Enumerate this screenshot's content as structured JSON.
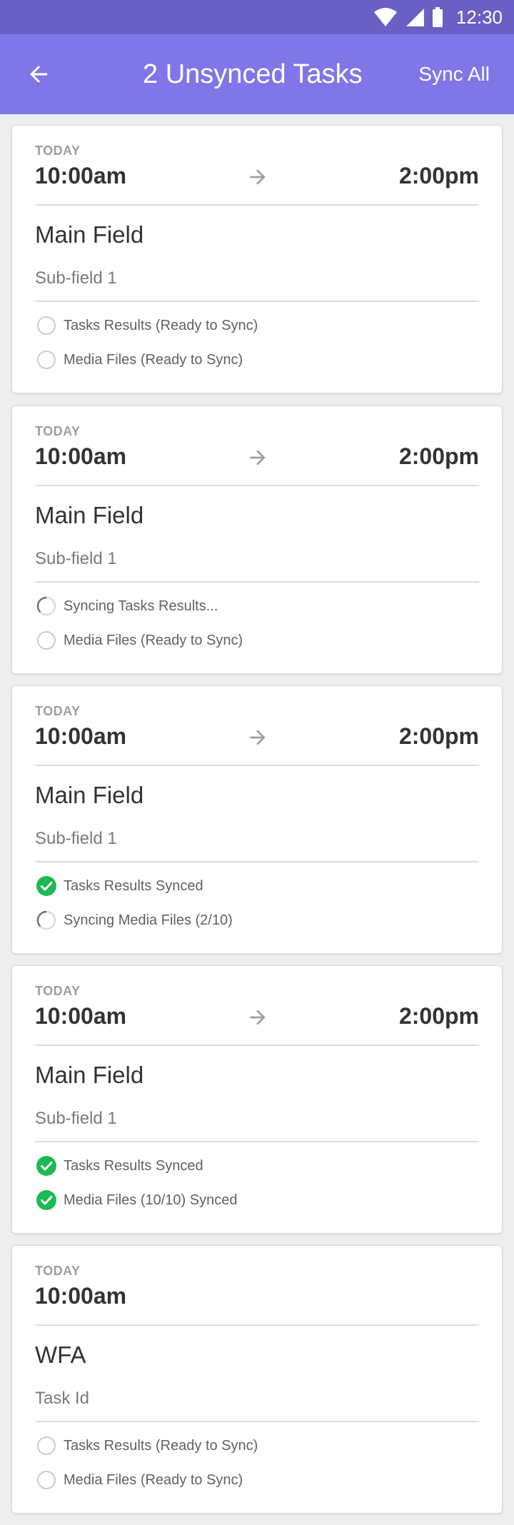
{
  "status_bar": {
    "time": "12:30",
    "icons": [
      "wifi-icon",
      "signal-icon",
      "battery-icon"
    ]
  },
  "app_bar": {
    "back_icon": "arrow-left-icon",
    "title": "2 Unsynced Tasks",
    "sync_all_label": "Sync All"
  },
  "colors": {
    "primary": "#7f77e8",
    "status_bar": "#6a5fc4",
    "success": "#1db954",
    "pending": "#cccccc"
  },
  "cards": [
    {
      "day": "TODAY",
      "start": "10:00am",
      "end": "2:00pm",
      "show_end": true,
      "main": "Main Field",
      "sub": "Sub-field 1",
      "statuses": [
        {
          "state": "pending",
          "label": "Tasks Results (Ready to Sync)"
        },
        {
          "state": "pending",
          "label": "Media Files (Ready to Sync)"
        }
      ]
    },
    {
      "day": "TODAY",
      "start": "10:00am",
      "end": "2:00pm",
      "show_end": true,
      "main": "Main Field",
      "sub": "Sub-field 1",
      "statuses": [
        {
          "state": "syncing",
          "label": "Syncing Tasks Results..."
        },
        {
          "state": "pending",
          "label": "Media Files (Ready to Sync)"
        }
      ]
    },
    {
      "day": "TODAY",
      "start": "10:00am",
      "end": "2:00pm",
      "show_end": true,
      "main": "Main Field",
      "sub": "Sub-field 1",
      "statuses": [
        {
          "state": "done",
          "label": "Tasks Results Synced"
        },
        {
          "state": "syncing",
          "label": "Syncing Media Files (2/10)"
        }
      ]
    },
    {
      "day": "TODAY",
      "start": "10:00am",
      "end": "2:00pm",
      "show_end": true,
      "main": "Main Field",
      "sub": "Sub-field 1",
      "statuses": [
        {
          "state": "done",
          "label": "Tasks Results Synced"
        },
        {
          "state": "done",
          "label": "Media Files (10/10) Synced"
        }
      ]
    },
    {
      "day": "TODAY",
      "start": "10:00am",
      "end": "",
      "show_end": false,
      "main": "WFA",
      "sub": "Task Id",
      "statuses": [
        {
          "state": "pending",
          "label": "Tasks Results (Ready to Sync)"
        },
        {
          "state": "pending",
          "label": "Media Files (Ready to Sync)"
        }
      ]
    }
  ]
}
